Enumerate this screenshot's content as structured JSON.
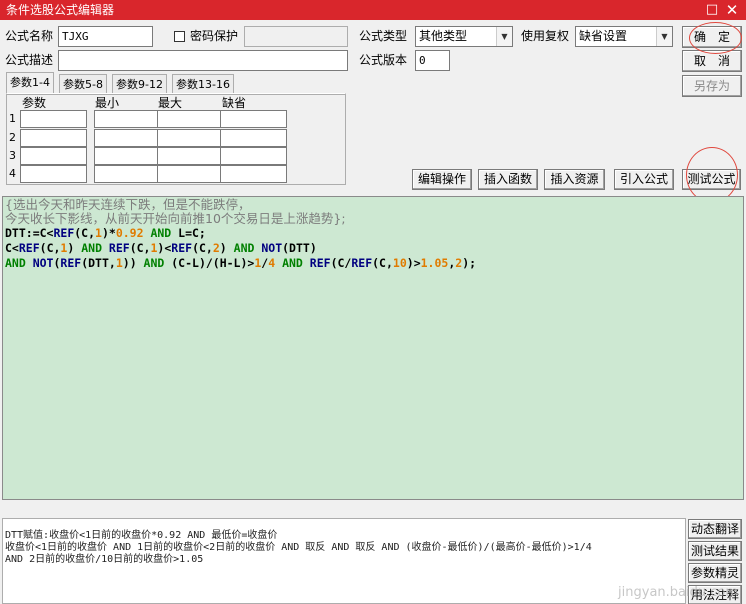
{
  "window": {
    "title": "条件选股公式编辑器",
    "max_glyph": "□",
    "close_glyph": "✕"
  },
  "form": {
    "name_label": "公式名称",
    "name_value": "TJXG",
    "password_label": "密码保护",
    "type_label": "公式类型",
    "type_value": "其他类型",
    "restore_label": "使用复权",
    "restore_value": "缺省设置",
    "desc_label": "公式描述",
    "desc_value": "",
    "version_label": "公式版本",
    "version_value": "0"
  },
  "buttons": {
    "ok": "确　定",
    "cancel": "取　消",
    "save_as": "另存为",
    "edit_ops": "编辑操作",
    "insert_func": "插入函数",
    "insert_res": "插入资源",
    "import_formula": "引入公式",
    "test_formula": "测试公式"
  },
  "tabs": [
    "参数1-4",
    "参数5-8",
    "参数9-12",
    "参数13-16"
  ],
  "params": {
    "headers": [
      "参数",
      "最小",
      "最大",
      "缺省"
    ],
    "rows": [
      "1",
      "2",
      "3",
      "4"
    ]
  },
  "editor": {
    "comment_line1": "{选出今天和昨天连续下跌，但是不能跌停，",
    "comment_line2": "今天收长下影线，从前天开始向前推10个交易日是上涨趋势};",
    "code": [
      [
        [
          "p",
          "DTT:=C<"
        ],
        [
          "fn",
          "REF"
        ],
        [
          "p",
          "(C,"
        ],
        [
          "num",
          "1"
        ],
        [
          "p",
          ")*"
        ],
        [
          "num",
          "0.92"
        ],
        [
          "kw",
          " AND "
        ],
        [
          "p",
          "L=C;"
        ]
      ],
      [
        [
          "p",
          "C<"
        ],
        [
          "fn",
          "REF"
        ],
        [
          "p",
          "(C,"
        ],
        [
          "num",
          "1"
        ],
        [
          "p",
          ")"
        ],
        [
          "kw",
          " AND "
        ],
        [
          "fn",
          "REF"
        ],
        [
          "p",
          "(C,"
        ],
        [
          "num",
          "1"
        ],
        [
          "p",
          ")<"
        ],
        [
          "fn",
          "REF"
        ],
        [
          "p",
          "(C,"
        ],
        [
          "num",
          "2"
        ],
        [
          "p",
          ")"
        ],
        [
          "kw",
          " AND "
        ],
        [
          "fn",
          "NOT"
        ],
        [
          "p",
          "(DTT)"
        ]
      ],
      [
        [
          "kw",
          "AND "
        ],
        [
          "fn",
          "NOT"
        ],
        [
          "p",
          "("
        ],
        [
          "fn",
          "REF"
        ],
        [
          "p",
          "(DTT,"
        ],
        [
          "num",
          "1"
        ],
        [
          "p",
          "))"
        ],
        [
          "kw",
          " AND "
        ],
        [
          "p",
          "(C-L)/(H-L)>"
        ],
        [
          "num",
          "1"
        ],
        [
          "p",
          "/"
        ],
        [
          "num",
          "4"
        ],
        [
          "kw",
          " AND "
        ],
        [
          "fn",
          "REF"
        ],
        [
          "p",
          "(C/"
        ],
        [
          "fn",
          "REF"
        ],
        [
          "p",
          "(C,"
        ],
        [
          "num",
          "10"
        ],
        [
          "p",
          ")>"
        ],
        [
          "num",
          "1.05"
        ],
        [
          "p",
          ","
        ],
        [
          "num",
          "2"
        ],
        [
          "p",
          ");"
        ]
      ]
    ]
  },
  "output": {
    "line1": "DTT赋值:收盘价<1日前的收盘价*0.92 AND 最低价=收盘价",
    "line2": "收盘价<1日前的收盘价 AND 1日前的收盘价<2日前的收盘价 AND 取反 AND 取反 AND (收盘价-最低价)/(最高价-最低价)>1/4",
    "line3": "AND 2日前的收盘价/10日前的收盘价>1.05"
  },
  "side_buttons": [
    "动态翻译",
    "测试结果",
    "参数精灵",
    "用法注释"
  ],
  "watermark": "jingyan.baidu.com",
  "colors": {
    "titlebar": "#d9262c",
    "editor_bg": "#cde8d2",
    "annotation_circle": "#e0483e"
  }
}
